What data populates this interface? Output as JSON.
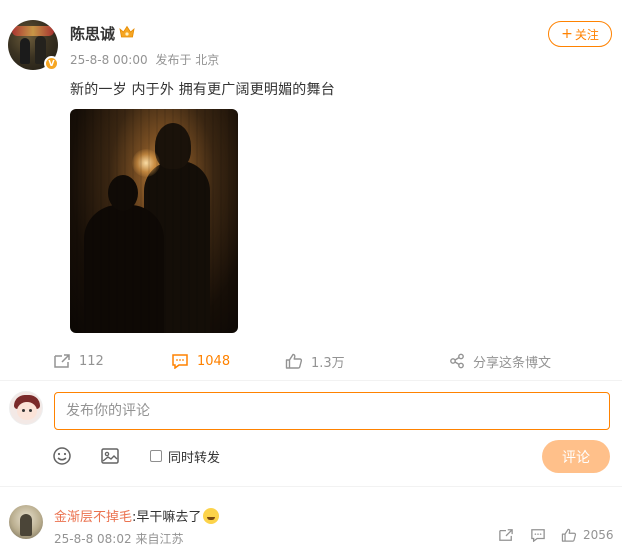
{
  "post": {
    "username": "陈思诚",
    "timestamp": "25-8-8 00:00",
    "location": "发布于 北京",
    "text": "新的一岁 内于外 拥有更广阔更明媚的舞台",
    "follow_label": "关注",
    "verified_badge": "V",
    "accent_color": "#ff8200"
  },
  "actions": {
    "repost_count": "112",
    "comment_count": "1048",
    "like_count": "1.3万",
    "share_label": "分享这条博文"
  },
  "composer": {
    "placeholder": "发布你的评论",
    "repost_label": "同时转发",
    "submit_label": "评论",
    "icons": [
      "emoji-icon",
      "image-icon"
    ]
  },
  "comments": [
    {
      "user": "金渐层不掉毛",
      "text": ":早干嘛去了",
      "timestamp": "25-8-8 08:02",
      "location": "来自江苏",
      "like_count": "2056"
    }
  ]
}
